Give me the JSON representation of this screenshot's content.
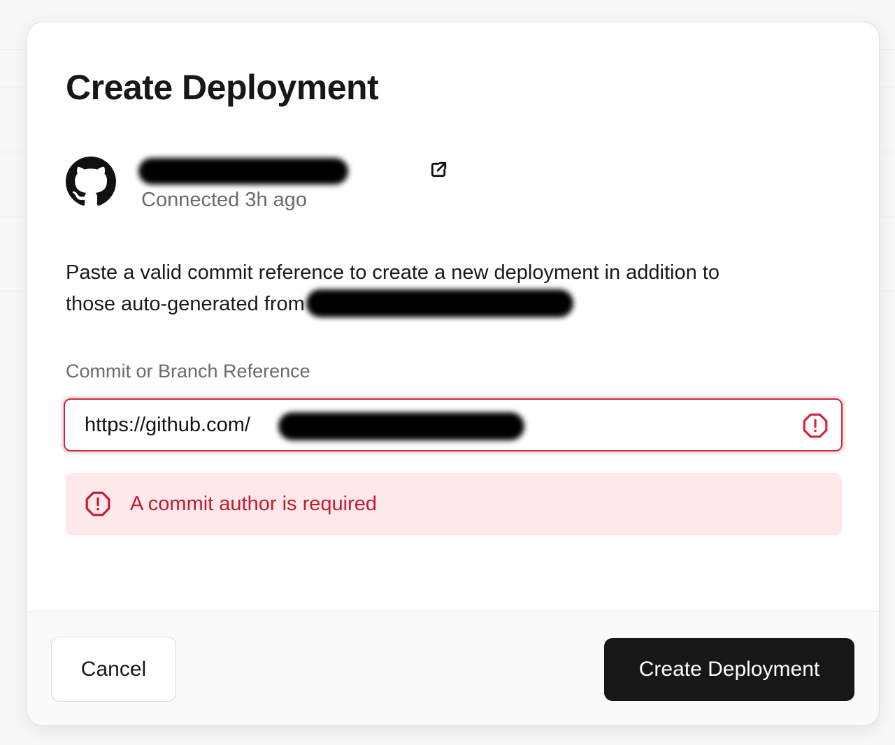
{
  "modal": {
    "title": "Create Deployment",
    "repo": {
      "name": "",
      "status": "Connected 3h ago"
    },
    "description": {
      "line1": "Paste a valid commit reference to create a new deployment in addition to",
      "line2": "those auto-generated from"
    },
    "field": {
      "label": "Commit or Branch Reference",
      "value": "https://github.com/"
    },
    "error": {
      "message": "A commit author is required"
    },
    "footer": {
      "cancel_label": "Cancel",
      "create_label": "Create Deployment"
    }
  },
  "colors": {
    "error": "#d1253a",
    "error_bg": "#fde8ea",
    "primary_button": "#171717"
  },
  "icons": [
    "github-icon",
    "external-link-icon",
    "error-octagon-icon"
  ]
}
